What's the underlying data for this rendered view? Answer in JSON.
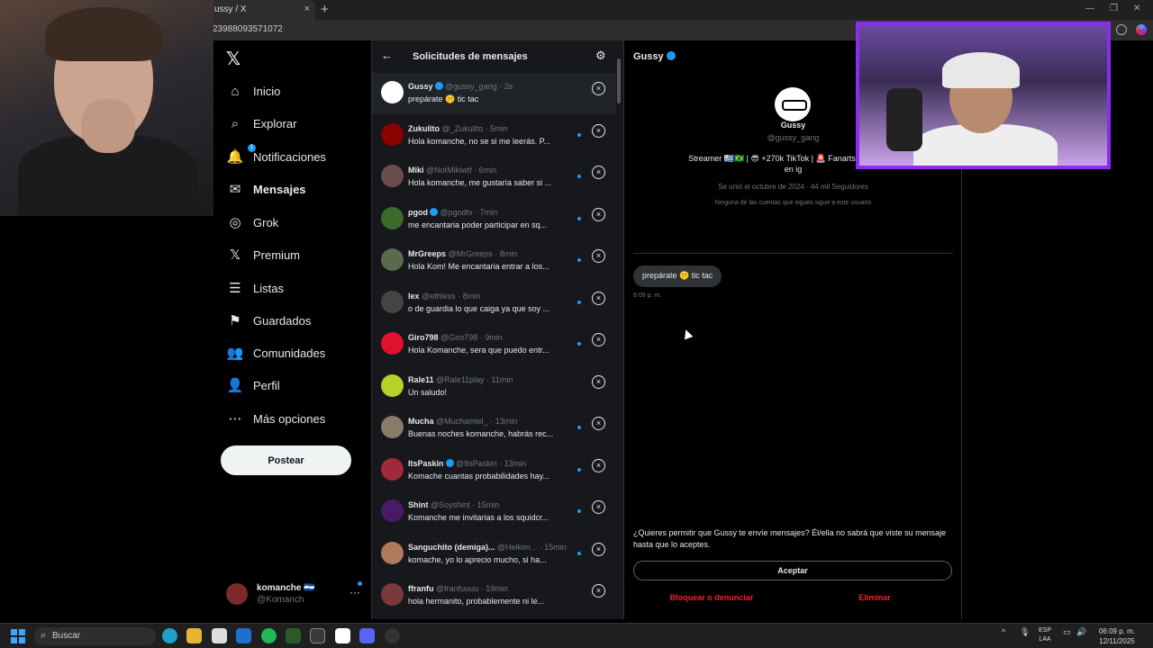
{
  "browser": {
    "tab_title": "ussy / X",
    "tab_close": "×",
    "new_tab": "+",
    "url": "23988093571072"
  },
  "nav": {
    "logo": "𝕏",
    "items": [
      {
        "label": "Inicio",
        "icon": "⌂"
      },
      {
        "label": "Explorar",
        "icon": "⌕"
      },
      {
        "label": "Notificaciones",
        "icon": "🔔",
        "badge": "1"
      },
      {
        "label": "Mensajes",
        "icon": "✉"
      },
      {
        "label": "Grok",
        "icon": "◎"
      },
      {
        "label": "Premium",
        "icon": "𝕏"
      },
      {
        "label": "Listas",
        "icon": "☰"
      },
      {
        "label": "Guardados",
        "icon": "⚑"
      },
      {
        "label": "Comunidades",
        "icon": "👥"
      },
      {
        "label": "Perfil",
        "icon": "👤"
      },
      {
        "label": "Más opciones",
        "icon": "⋯"
      }
    ],
    "post_label": "Postear",
    "profile": {
      "name": "komanche 🇸🇻",
      "handle": "@Komanch",
      "more": "···"
    }
  },
  "requests": {
    "title": "Solicitudes de mensajes",
    "back_icon": "←",
    "settings_icon": "⚙",
    "rows": [
      {
        "name": "Gussy",
        "verified": true,
        "handle": "@gussy_gang",
        "time": "· 2s",
        "message": "prepárate 🤫 tic tac",
        "unread": false,
        "avatar_color": "#ffffff"
      },
      {
        "name": "Zukulito",
        "verified": false,
        "handle": "@_Zukulito",
        "time": "· 5min",
        "message": "Hola komanche, no se si me leerás. P...",
        "unread": true,
        "avatar_color": "#8b0000"
      },
      {
        "name": "Miki",
        "verified": false,
        "handle": "@NotMikiwtf",
        "time": "· 6min",
        "message": "Hola komanche, me gustaría saber si ...",
        "unread": true,
        "avatar_color": "#6b4c4c"
      },
      {
        "name": "pgod",
        "verified": true,
        "handle": "@pgodtv",
        "time": "· 7min",
        "message": "me encantaria poder participar en sq...",
        "unread": true,
        "avatar_color": "#3a6b2a"
      },
      {
        "name": "MrGreeps",
        "verified": false,
        "handle": "@MrGreeps",
        "time": "· 8min",
        "message": "Hola Kom! Me encantaria entrar a los...",
        "unread": true,
        "avatar_color": "#5a6a4a"
      },
      {
        "name": "lex",
        "verified": false,
        "handle": "@ethlexs",
        "time": "· 8min",
        "message": "o de guardia lo que caiga ya que soy ...",
        "unread": true,
        "avatar_color": "#444444"
      },
      {
        "name": "Giro798",
        "verified": false,
        "handle": "@Giro798",
        "time": "· 9min",
        "message": "Hola Komanche, sera que puedo entr...",
        "unread": true,
        "avatar_color": "#e0102f"
      },
      {
        "name": "Rale11",
        "verified": false,
        "handle": "@Rale11play",
        "time": "· 11min",
        "message": "Un saludo!",
        "unread": false,
        "avatar_color": "#b5d12a"
      },
      {
        "name": "Mucha",
        "verified": false,
        "handle": "@Muchamiel_",
        "time": "· 13min",
        "message": "Buenas noches komanche, habrás rec...",
        "unread": true,
        "avatar_color": "#8a7a6a"
      },
      {
        "name": "ItsPaskin",
        "verified": true,
        "handle": "@ItsPaskin",
        "time": "· 13min",
        "message": "Komache cuantas probabilidades hay...",
        "unread": true,
        "avatar_color": "#a02a3a"
      },
      {
        "name": "Shint",
        "verified": false,
        "handle": "@Soyshint",
        "time": "· 15min",
        "message": "Komanche me invitarias a los squidcr...",
        "unread": true,
        "avatar_color": "#4a1a6a"
      },
      {
        "name": "Sanguchito (demiga)...",
        "verified": false,
        "handle": "@Helkim...",
        "time": "· 15min",
        "message": "komache, yo lo aprecio mucho, si ha...",
        "unread": true,
        "avatar_color": "#b07a5a"
      },
      {
        "name": "ffranfu",
        "verified": false,
        "handle": "@franfuuuu",
        "time": "· 19min",
        "message": "hola hermanito, probablemente ni le...",
        "unread": false,
        "avatar_color": "#7a3a3a"
      }
    ],
    "close_icon": "×"
  },
  "conversation": {
    "title": "Gussy",
    "name": "Gussy",
    "handle": "@gussy_gang",
    "bio": "Streamer 🇺🇾🇧🇷 | 😎 +270k TikTok | 🚨 Fanarts: #GussyArt",
    "bio2": "en ig",
    "joined": "Se unió el octubre de 2024 · 44 mil Seguidores",
    "follow_note": "Ninguna de las cuentas que sigues sigue a este usuario",
    "message": "prepárate 🤫 tic tac",
    "message_time": "6:09 p. m.",
    "accept_prompt": "¿Quieres permitir que Gussy te envíe mensajes? Él/ella no sabrá que viste su mensaje hasta que lo aceptes.",
    "accept_label": "Aceptar",
    "block_label": "Bloquear o denunciar",
    "delete_label": "Eliminar"
  },
  "taskbar": {
    "search_placeholder": "Buscar",
    "search_icon": "⌕",
    "lang_line1": "ESP",
    "lang_line2": "LAA",
    "time": "06:09 p. m.",
    "date": "12/11/2025",
    "tray_up": "^"
  },
  "colors": {
    "accent": "#1d9bf0",
    "danger": "#f4212e",
    "stream_frame": "#8b2cf0"
  }
}
